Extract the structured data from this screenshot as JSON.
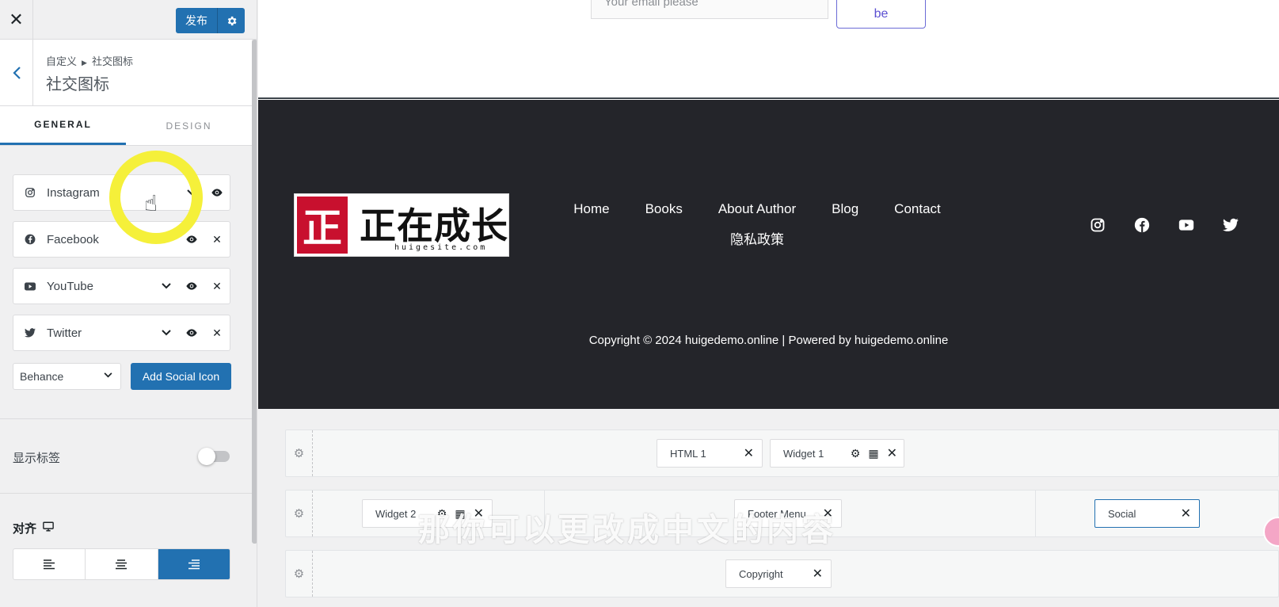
{
  "topbar": {
    "close_label": "✕",
    "publish_label": "发布"
  },
  "header": {
    "breadcrumb_root": "自定义",
    "breadcrumb_current": "社交图标",
    "title": "社交图标"
  },
  "tabs": [
    {
      "label": "GENERAL",
      "active": true
    },
    {
      "label": "DESIGN",
      "active": false
    }
  ],
  "social_items": [
    {
      "name": "Instagram",
      "icon": "instagram-icon"
    },
    {
      "name": "Facebook",
      "icon": "facebook-icon"
    },
    {
      "name": "YouTube",
      "icon": "youtube-icon"
    },
    {
      "name": "Twitter",
      "icon": "twitter-icon"
    }
  ],
  "add_social": {
    "select_value": "Behance",
    "button_label": "Add Social Icon"
  },
  "show_label": {
    "label": "显示标签",
    "enabled": false
  },
  "alignment": {
    "label": "对齐",
    "selected": "right"
  },
  "preview": {
    "email_placeholder": "Your email please",
    "subscribe_label": "be",
    "logo_text": "正在成长",
    "logo_stamp": "正",
    "logo_site": "huigesite.com",
    "nav_items": [
      "Home",
      "Books",
      "About Author",
      "Blog",
      "Contact"
    ],
    "nav_second_row": "隐私政策",
    "copyright": "Copyright © 2024 huigedemo.online | Powered by huigedemo.online",
    "footer_bg": "#24252a",
    "accent": "#2271b1"
  },
  "builder": {
    "row1": {
      "chips": [
        "HTML 1",
        "Widget 1"
      ]
    },
    "row2": {
      "chips": [
        "Widget 2",
        "Footer Menu",
        "Social"
      ]
    },
    "row3": {
      "chips": [
        "Copyright"
      ]
    }
  },
  "subtitle": "那你可以更改成中文的内容"
}
